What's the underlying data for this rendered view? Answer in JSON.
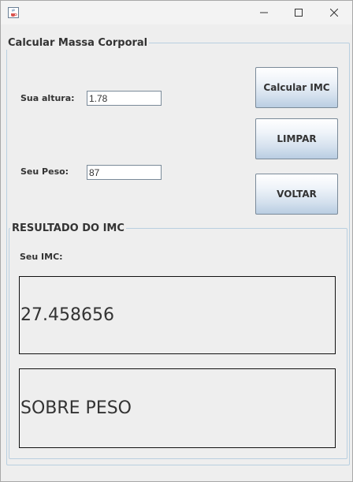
{
  "window": {
    "icon": "java-coffee-icon",
    "controls": [
      "minimize-icon",
      "maximize-icon",
      "close-icon"
    ]
  },
  "form": {
    "title": "Calcular Massa Corporal",
    "altura_label": "Sua altura:",
    "altura_value": "1.78",
    "peso_label": "Seu Peso:",
    "peso_value": "87"
  },
  "buttons": {
    "calcular": "Calcular IMC",
    "limpar": "LIMPAR",
    "voltar": "VOLTAR"
  },
  "result": {
    "title": "RESULTADO DO IMC",
    "imc_label": "Seu IMC:",
    "imc_value": "27.458656",
    "classification": "SOBRE PESO"
  },
  "colors": {
    "button_gradient_bottom": "#b9cde2",
    "group_border": "#b9cfe0",
    "background": "#eeeeee"
  }
}
